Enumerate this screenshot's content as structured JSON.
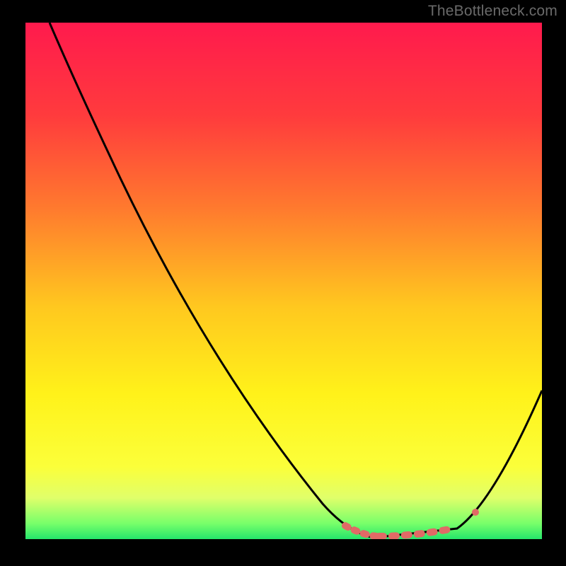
{
  "watermark": "TheBottleneck.com",
  "chart_data": {
    "type": "line",
    "title": "",
    "xlabel": "",
    "ylabel": "",
    "xlim": [
      0,
      100
    ],
    "ylim": [
      0,
      100
    ],
    "grid": false,
    "series": [
      {
        "name": "bottleneck-curve",
        "x": [
          4,
          10,
          16,
          25,
          35,
          45,
          55,
          62,
          68,
          75,
          82,
          88,
          95,
          100
        ],
        "values": [
          100,
          92,
          80,
          64,
          46,
          30,
          14,
          6,
          1,
          0,
          1,
          4,
          14,
          29
        ]
      }
    ],
    "annotations": [
      {
        "name": "recommended-range",
        "style": "dashed",
        "color": "#e06a66",
        "x_range": [
          62,
          87
        ],
        "y_approx": 1
      }
    ],
    "background_gradient": {
      "axis": "y",
      "stops": [
        {
          "pos": 0.0,
          "color": "#ff1a4d"
        },
        {
          "pos": 0.18,
          "color": "#ff3b3d"
        },
        {
          "pos": 0.36,
          "color": "#ff7a2e"
        },
        {
          "pos": 0.55,
          "color": "#ffc81f"
        },
        {
          "pos": 0.72,
          "color": "#fff21a"
        },
        {
          "pos": 0.86,
          "color": "#fbff3a"
        },
        {
          "pos": 0.92,
          "color": "#e0ff6a"
        },
        {
          "pos": 0.97,
          "color": "#77ff6a"
        },
        {
          "pos": 1.0,
          "color": "#25e56b"
        }
      ]
    }
  }
}
